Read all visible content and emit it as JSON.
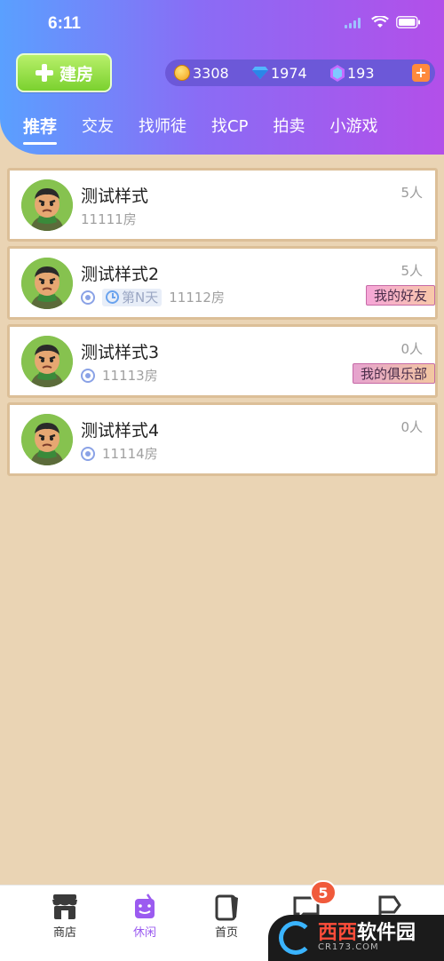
{
  "status_bar": {
    "time": "6:11"
  },
  "header": {
    "build_button_label": "建房",
    "currency": {
      "coins": "3308",
      "diamonds": "1974",
      "gems": "193",
      "add_label": "+"
    },
    "tabs": [
      {
        "label": "推荐",
        "active": true
      },
      {
        "label": "交友",
        "active": false
      },
      {
        "label": "找师徒",
        "active": false
      },
      {
        "label": "找CP",
        "active": false
      },
      {
        "label": "拍卖",
        "active": false
      },
      {
        "label": "小游戏",
        "active": false
      }
    ]
  },
  "rooms": [
    {
      "title": "测试样式",
      "count": "5人",
      "room_no": "11111房",
      "days": "",
      "tag": ""
    },
    {
      "title": "测试样式2",
      "count": "5人",
      "room_no": "11112房",
      "days": "第N天",
      "tag": "我的好友"
    },
    {
      "title": "测试样式3",
      "count": "0人",
      "room_no": "11113房",
      "days": "",
      "tag": "我的俱乐部"
    },
    {
      "title": "测试样式4",
      "count": "0人",
      "room_no": "11114房",
      "days": "",
      "tag": ""
    }
  ],
  "bottom_nav": {
    "items": [
      {
        "label": "商店",
        "icon": "shop-icon",
        "active": false
      },
      {
        "label": "休闲",
        "icon": "drink-icon",
        "active": true
      },
      {
        "label": "首页",
        "icon": "home-icon",
        "active": false
      },
      {
        "label": "",
        "icon": "message-icon",
        "active": false
      },
      {
        "label": "",
        "icon": "flag-icon",
        "active": false
      }
    ],
    "message_badge": "5"
  },
  "watermark": {
    "main_a": "西西",
    "main_b": "软件园",
    "sub": "CR173.COM"
  },
  "colors": {
    "accent": "#9b5bf0",
    "background": "#ead4b4",
    "header_start": "#5aa0ff",
    "header_end": "#b34fe9",
    "build_button": "#7bd12f",
    "badge": "#f05a3b"
  }
}
